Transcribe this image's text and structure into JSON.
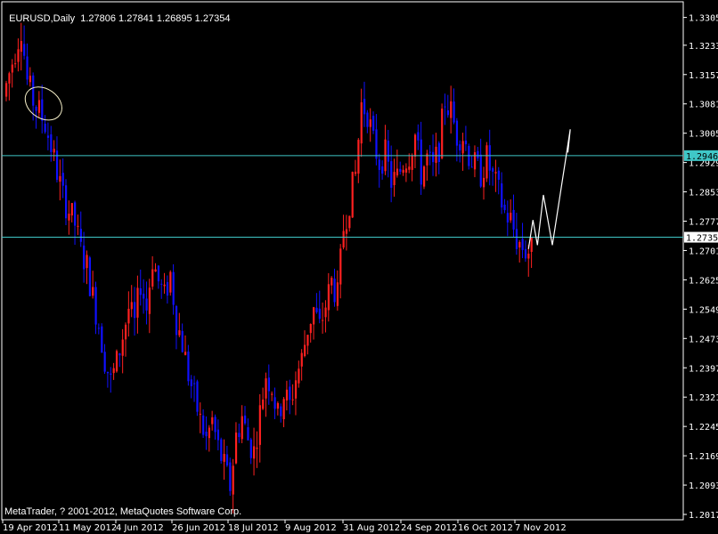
{
  "header": {
    "symbol_timeframe": "EURUSD,Daily",
    "ohlc": "1.27806 1.27841 1.26895 1.27354"
  },
  "footer": {
    "copyright": "MetaTrader, ? 2001-2012, MetaQuotes Software Corp."
  },
  "colors": {
    "background": "#000000",
    "bull_candle": "#ff2020",
    "bear_candle": "#1010ff",
    "h_line": "#3fc7c7",
    "axis": "#ffffff",
    "drawing": "#ffffff",
    "marker_highlight_bg": "#3fc7c7",
    "marker_current_bg": "#ffffff"
  },
  "chart_data": {
    "type": "candlestick",
    "symbol": "EURUSD",
    "timeframe": "Daily",
    "ylim": [
      1.2,
      1.335
    ],
    "y_ticks": [
      "1.33050",
      "1.32330",
      "1.31570",
      "1.30810",
      "1.30050",
      "1.29290",
      "1.28530",
      "1.27770",
      "1.27010",
      "1.26250",
      "1.25490",
      "1.24730",
      "1.23970",
      "1.23210",
      "1.22450",
      "1.21690",
      "1.20930",
      "1.20170"
    ],
    "x_ticks": [
      "19 Apr 2012",
      "11 May 2012",
      "4 Jun 2012",
      "26 Jun 2012",
      "18 Jul 2012",
      "9 Aug 2012",
      "31 Aug 2012",
      "24 Sep 2012",
      "16 Oct 2012",
      "7 Nov 2012"
    ],
    "horizontal_lines": [
      {
        "price": 1.29469,
        "label": "1.29469",
        "style": "highlight"
      },
      {
        "price": 1.27354,
        "label": "1.27354",
        "style": "current"
      }
    ],
    "path": [
      [
        0,
        1.31
      ],
      [
        6,
        1.328
      ],
      [
        8,
        1.314
      ],
      [
        10,
        1.309
      ],
      [
        14,
        1.303
      ],
      [
        16,
        1.297
      ],
      [
        20,
        1.284
      ],
      [
        24,
        1.277
      ],
      [
        26,
        1.27
      ],
      [
        28,
        1.266
      ],
      [
        30,
        1.258
      ],
      [
        32,
        1.251
      ],
      [
        34,
        1.242
      ],
      [
        36,
        1.236
      ],
      [
        38,
        1.241
      ],
      [
        40,
        1.248
      ],
      [
        42,
        1.255
      ],
      [
        44,
        1.251
      ],
      [
        46,
        1.262
      ],
      [
        48,
        1.255
      ],
      [
        50,
        1.268
      ],
      [
        52,
        1.262
      ],
      [
        54,
        1.258
      ],
      [
        56,
        1.264
      ],
      [
        58,
        1.252
      ],
      [
        60,
        1.246
      ],
      [
        62,
        1.238
      ],
      [
        64,
        1.232
      ],
      [
        66,
        1.226
      ],
      [
        68,
        1.221
      ],
      [
        70,
        1.226
      ],
      [
        72,
        1.219
      ],
      [
        74,
        1.214
      ],
      [
        76,
        1.209
      ],
      [
        78,
        1.222
      ],
      [
        80,
        1.227
      ],
      [
        82,
        1.221
      ],
      [
        84,
        1.218
      ],
      [
        86,
        1.228
      ],
      [
        88,
        1.238
      ],
      [
        90,
        1.235
      ],
      [
        92,
        1.227
      ],
      [
        94,
        1.233
      ],
      [
        96,
        1.23
      ],
      [
        98,
        1.237
      ],
      [
        100,
        1.242
      ],
      [
        102,
        1.25
      ],
      [
        104,
        1.255
      ],
      [
        106,
        1.25
      ],
      [
        108,
        1.256
      ],
      [
        110,
        1.262
      ],
      [
        112,
        1.258
      ],
      [
        114,
        1.276
      ],
      [
        116,
        1.283
      ],
      [
        118,
        1.29
      ],
      [
        120,
        1.308
      ],
      [
        122,
        1.306
      ],
      [
        124,
        1.298
      ],
      [
        126,
        1.293
      ],
      [
        128,
        1.295
      ],
      [
        130,
        1.288
      ],
      [
        132,
        1.289
      ],
      [
        134,
        1.293
      ],
      [
        136,
        1.295
      ],
      [
        138,
        1.3
      ],
      [
        140,
        1.29
      ],
      [
        142,
        1.294
      ],
      [
        144,
        1.291
      ],
      [
        146,
        1.297
      ],
      [
        148,
        1.309
      ],
      [
        150,
        1.306
      ],
      [
        152,
        1.3
      ],
      [
        154,
        1.3
      ],
      [
        156,
        1.295
      ],
      [
        158,
        1.292
      ],
      [
        160,
        1.29
      ],
      [
        162,
        1.294
      ],
      [
        164,
        1.289
      ],
      [
        166,
        1.285
      ],
      [
        168,
        1.28
      ],
      [
        170,
        1.278
      ],
      [
        172,
        1.273
      ],
      [
        174,
        1.271
      ],
      [
        175,
        1.27
      ]
    ],
    "x_max": 176,
    "drawings": {
      "ellipse": {
        "t": 12.5,
        "price": 1.3082,
        "rx_t": 3.5,
        "ry_price": 0.0038
      },
      "forecast_line": [
        [
          175,
          1.2705
        ],
        [
          176.5,
          1.278
        ],
        [
          178,
          1.2715
        ],
        [
          180,
          1.2845
        ],
        [
          183,
          1.2715
        ],
        [
          189,
          1.3015
        ],
        [
          188.2,
          1.2955
        ],
        [
          189,
          1.3015
        ]
      ]
    }
  }
}
